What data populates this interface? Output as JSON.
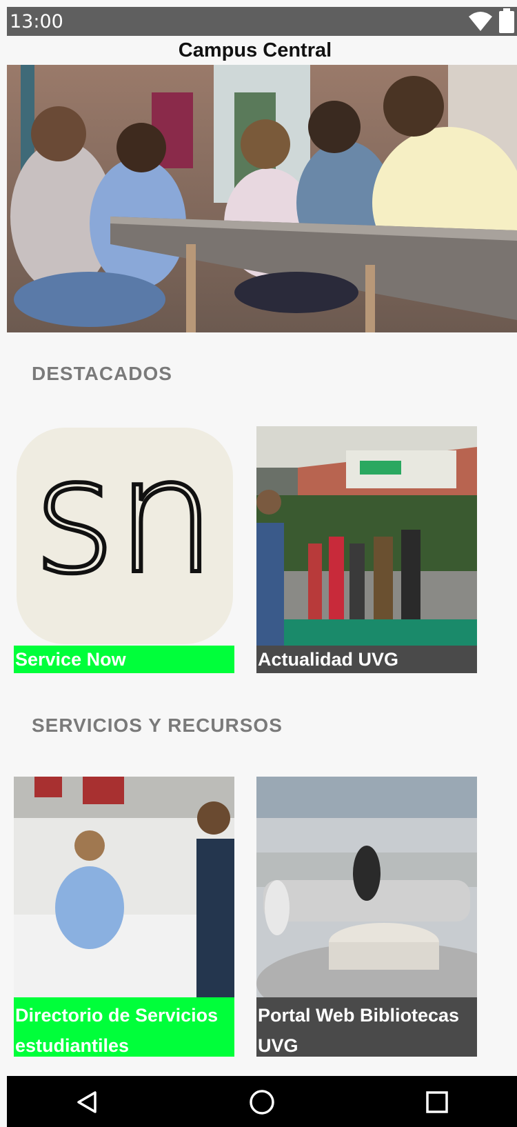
{
  "status_bar": {
    "time": "13:00",
    "wifi_icon": "wifi-icon",
    "battery_icon": "battery-icon"
  },
  "app_bar": {
    "title": "Campus Central"
  },
  "hero": {
    "image": "students-studying-photo"
  },
  "sections": {
    "featured": {
      "title": "DESTACADOS",
      "cards": [
        {
          "label": "Service Now",
          "logo_text": "sn",
          "label_color": "#00ff3a"
        },
        {
          "label": "Actualidad UVG",
          "label_color": "#4a4a4a"
        }
      ]
    },
    "services": {
      "title": "SERVICIOS Y RECURSOS",
      "cards": [
        {
          "label_line1": "Directorio de Servicios",
          "label_line2": "estudiantiles",
          "label_color": "#00ff3a"
        },
        {
          "label_line1": "Portal Web Bibliotecas",
          "label_line2": "UVG",
          "label_color": "#4a4a4a"
        }
      ]
    }
  },
  "nav_bar": {
    "back_icon": "back-triangle-icon",
    "home_icon": "home-circle-icon",
    "recents_icon": "recents-square-icon"
  }
}
